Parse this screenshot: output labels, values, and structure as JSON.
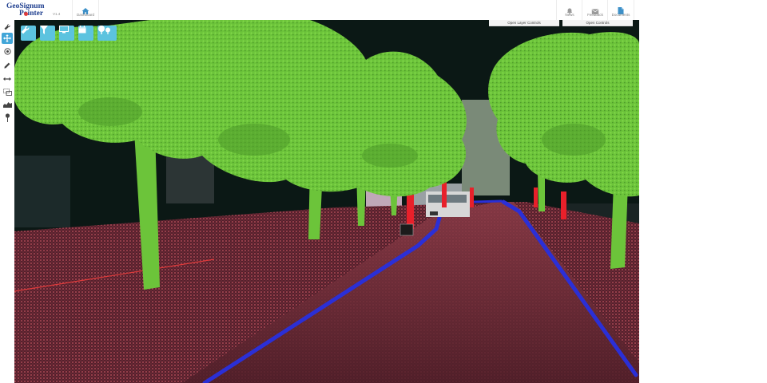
{
  "app": {
    "logo_top": "GeoSignum",
    "logo_bottom": "Pointer",
    "logo_version": "V1.4"
  },
  "nav": {
    "dashboard": "Dashboard",
    "news": "News",
    "feedback": "Feedback",
    "documents": "Documents"
  },
  "controls": {
    "layer": "Open Layer Controls",
    "open": "Open Controls"
  },
  "toolbar_left": [
    "wrench-icon",
    "move-icon",
    "target-icon",
    "pencil-icon",
    "measure-distance-icon",
    "area-select-icon",
    "profile-icon",
    "pin-icon"
  ],
  "toolbar_floating": [
    "wrench-icon",
    "filter-icon",
    "monitor-icon",
    "calendar-icon",
    "trees-icon"
  ],
  "colors": {
    "accent": "#42a6d8",
    "tool_button": "#5cc3df",
    "vegetation": "#6cc43a",
    "ground": "#6e2a35",
    "road_marking": "#2b2fd6",
    "poles": "#e8202a"
  }
}
